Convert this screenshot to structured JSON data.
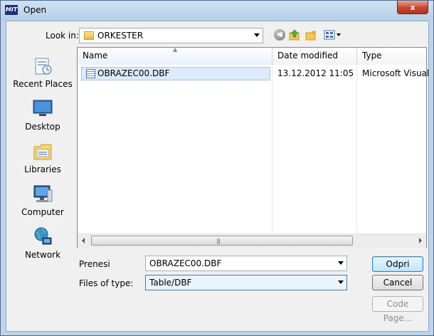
{
  "window": {
    "title": "Open",
    "app_icon_text": "MIT",
    "close_label": "x"
  },
  "toolbar": {
    "look_in_label": "Look in:",
    "look_in_value": "ORKESTER"
  },
  "places": [
    {
      "label": "Recent Places",
      "icon": "recent-places-icon"
    },
    {
      "label": "Desktop",
      "icon": "desktop-icon"
    },
    {
      "label": "Libraries",
      "icon": "libraries-icon"
    },
    {
      "label": "Computer",
      "icon": "computer-icon"
    },
    {
      "label": "Network",
      "icon": "network-icon"
    }
  ],
  "file_list": {
    "columns": [
      "Name",
      "Date modified",
      "Type"
    ],
    "rows": [
      {
        "name": "OBRAZEC00.DBF",
        "date_modified": "13.12.2012 11:05",
        "type": "Microsoft Visual",
        "selected": true
      }
    ]
  },
  "form": {
    "filename_label": "Prenesi",
    "filename_value": "OBRAZEC00.DBF",
    "filetype_label": "Files of type:",
    "filetype_value": "Table/DBF"
  },
  "buttons": {
    "open": "Odpri",
    "cancel": "Cancel",
    "code_page": "Code Page..."
  },
  "colors": {
    "selection": "#dceafa",
    "title_gradient_top": "#cfe0f2",
    "close_red": "#c8452e"
  }
}
